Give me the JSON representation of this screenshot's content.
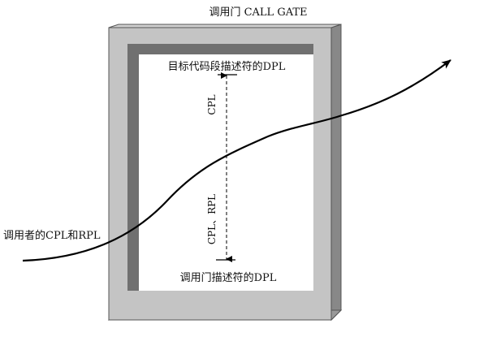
{
  "title": "调用门 CALL GATE",
  "labels": {
    "target_dpl": "目标代码段描述符的DPL",
    "gate_dpl": "调用门描述符的DPL",
    "caller": "调用者的CPL和RPL",
    "axis_upper": "CPL",
    "axis_lower": "CPL、RPL"
  },
  "colors": {
    "frame_face": "#bfbfbf",
    "frame_dark": "#777777",
    "frame_border": "#555555",
    "inner_shadow": "#6e6e6e",
    "line": "#000000",
    "background": "#ffffff"
  }
}
